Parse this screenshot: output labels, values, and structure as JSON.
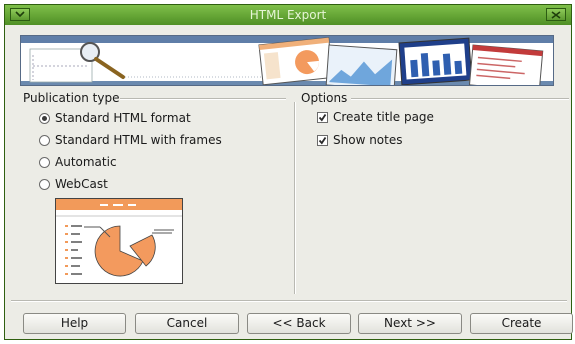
{
  "window": {
    "title": "HTML Export"
  },
  "publication_type": {
    "label": "Publication type",
    "options": [
      {
        "label": "Standard HTML format",
        "selected": true
      },
      {
        "label": "Standard HTML with frames",
        "selected": false
      },
      {
        "label": "Automatic",
        "selected": false
      },
      {
        "label": "WebCast",
        "selected": false
      }
    ]
  },
  "options": {
    "label": "Options",
    "create_title_page": {
      "label": "Create title page",
      "checked": true
    },
    "show_notes": {
      "label": "Show notes",
      "checked": true
    }
  },
  "buttons": {
    "help": "Help",
    "cancel": "Cancel",
    "back": "<< Back",
    "next": "Next >>",
    "create": "Create"
  },
  "colors": {
    "titlebar": "#5f9f30",
    "banner_strip": "#5f7ea8",
    "pie": "#f39a5e"
  },
  "icons": [
    "window-menu-icon",
    "close-icon",
    "magnifier-icon",
    "radio-icon",
    "checkbox-icon"
  ]
}
